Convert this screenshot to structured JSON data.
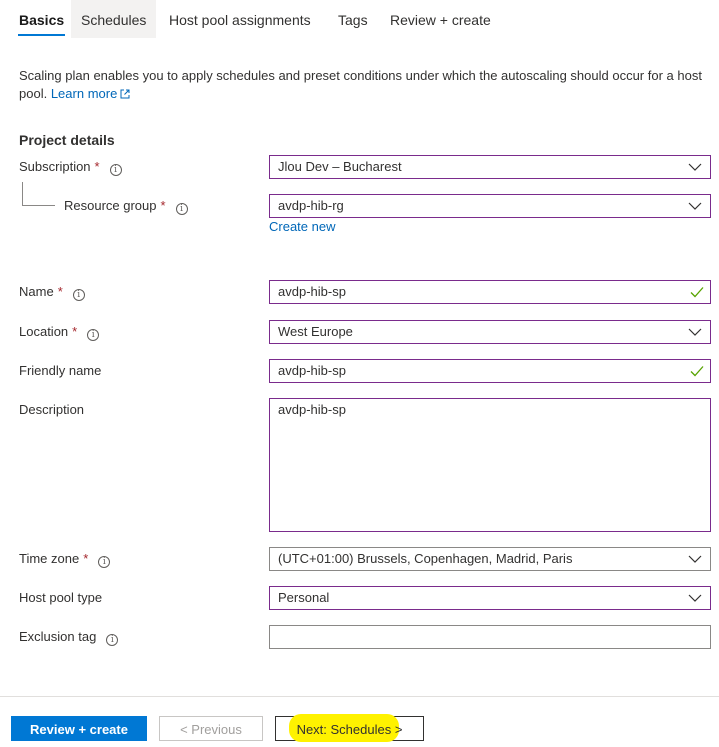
{
  "tabs": [
    {
      "label": "Basics"
    },
    {
      "label": "Schedules"
    },
    {
      "label": "Host pool assignments"
    },
    {
      "label": "Tags"
    },
    {
      "label": "Review + create"
    }
  ],
  "intro": {
    "text": "Scaling plan enables you to apply schedules and preset conditions under which the autoscaling should occur for a host pool.",
    "link": "Learn more"
  },
  "project_details": {
    "title": "Project details",
    "subscription": {
      "label": "Subscription",
      "value": "Jlou Dev – Bucharest"
    },
    "resource_group": {
      "label": "Resource group",
      "value": "avdp-hib-rg",
      "create_new": "Create new"
    }
  },
  "fields": {
    "name": {
      "label": "Name",
      "value": "avdp-hib-sp"
    },
    "location": {
      "label": "Location",
      "value": "West Europe"
    },
    "friendly_name": {
      "label": "Friendly name",
      "value": "avdp-hib-sp"
    },
    "description": {
      "label": "Description",
      "value": "avdp-hib-sp"
    },
    "time_zone": {
      "label": "Time zone",
      "value": "(UTC+01:00) Brussels, Copenhagen, Madrid, Paris"
    },
    "host_pool_type": {
      "label": "Host pool type",
      "value": "Personal"
    },
    "exclusion_tag": {
      "label": "Exclusion tag",
      "value": ""
    }
  },
  "required_marker": "*",
  "footer": {
    "review_create": "Review + create",
    "previous": "< Previous",
    "next": "Next: Schedules >"
  },
  "colors": {
    "accent": "#0078d4",
    "field_border": "#7a2b8c",
    "required": "#a4262c",
    "highlight": "#fff200"
  }
}
